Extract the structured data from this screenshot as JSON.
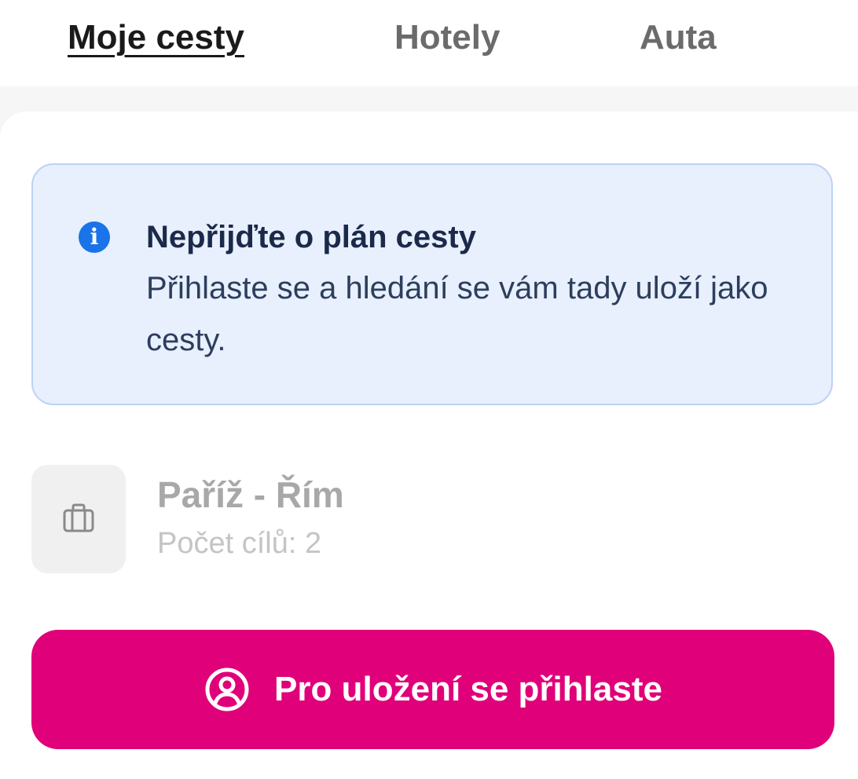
{
  "tabs": [
    {
      "label": "Moje cesty",
      "active": true
    },
    {
      "label": "Hotely",
      "active": false
    },
    {
      "label": "Auta",
      "active": false
    }
  ],
  "notice": {
    "icon": "info-icon",
    "title": "Nepřijďte o plán cesty",
    "text": "Přihlaste se a hledání se vám tady uloží jako cesty."
  },
  "trip": {
    "icon": "briefcase-icon",
    "title": "Paříž - Řím",
    "subtitle": "Počet cílů: 2"
  },
  "login_button": {
    "icon": "user-circle-icon",
    "label": "Pro uložení se přihlaste"
  },
  "colors": {
    "accent": "#e0007a",
    "notice_bg": "#e8effd",
    "notice_border": "#bcd2f6",
    "info_blue": "#1a73e8"
  }
}
